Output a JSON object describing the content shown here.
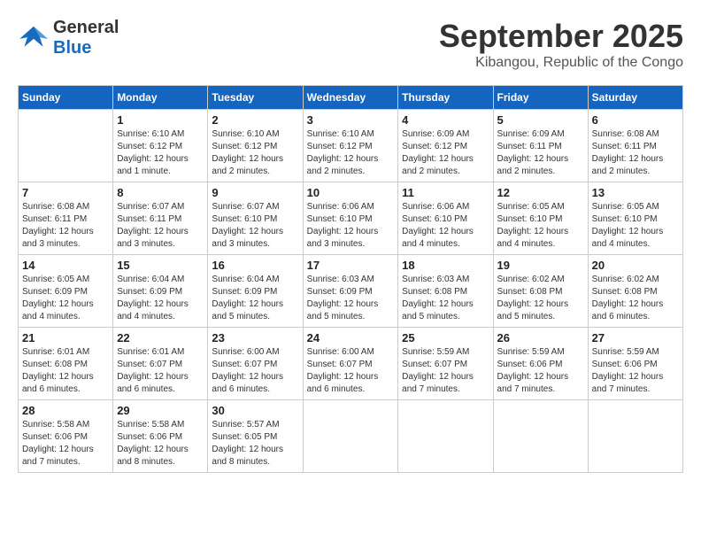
{
  "header": {
    "logo_general": "General",
    "logo_blue": "Blue",
    "month": "September 2025",
    "location": "Kibangou, Republic of the Congo"
  },
  "days_of_week": [
    "Sunday",
    "Monday",
    "Tuesday",
    "Wednesday",
    "Thursday",
    "Friday",
    "Saturday"
  ],
  "weeks": [
    [
      {
        "day": "",
        "sunrise": "",
        "sunset": "",
        "daylight": ""
      },
      {
        "day": "1",
        "sunrise": "Sunrise: 6:10 AM",
        "sunset": "Sunset: 6:12 PM",
        "daylight": "Daylight: 12 hours and 1 minute."
      },
      {
        "day": "2",
        "sunrise": "Sunrise: 6:10 AM",
        "sunset": "Sunset: 6:12 PM",
        "daylight": "Daylight: 12 hours and 2 minutes."
      },
      {
        "day": "3",
        "sunrise": "Sunrise: 6:10 AM",
        "sunset": "Sunset: 6:12 PM",
        "daylight": "Daylight: 12 hours and 2 minutes."
      },
      {
        "day": "4",
        "sunrise": "Sunrise: 6:09 AM",
        "sunset": "Sunset: 6:12 PM",
        "daylight": "Daylight: 12 hours and 2 minutes."
      },
      {
        "day": "5",
        "sunrise": "Sunrise: 6:09 AM",
        "sunset": "Sunset: 6:11 PM",
        "daylight": "Daylight: 12 hours and 2 minutes."
      },
      {
        "day": "6",
        "sunrise": "Sunrise: 6:08 AM",
        "sunset": "Sunset: 6:11 PM",
        "daylight": "Daylight: 12 hours and 2 minutes."
      }
    ],
    [
      {
        "day": "7",
        "sunrise": "Sunrise: 6:08 AM",
        "sunset": "Sunset: 6:11 PM",
        "daylight": "Daylight: 12 hours and 3 minutes."
      },
      {
        "day": "8",
        "sunrise": "Sunrise: 6:07 AM",
        "sunset": "Sunset: 6:11 PM",
        "daylight": "Daylight: 12 hours and 3 minutes."
      },
      {
        "day": "9",
        "sunrise": "Sunrise: 6:07 AM",
        "sunset": "Sunset: 6:10 PM",
        "daylight": "Daylight: 12 hours and 3 minutes."
      },
      {
        "day": "10",
        "sunrise": "Sunrise: 6:06 AM",
        "sunset": "Sunset: 6:10 PM",
        "daylight": "Daylight: 12 hours and 3 minutes."
      },
      {
        "day": "11",
        "sunrise": "Sunrise: 6:06 AM",
        "sunset": "Sunset: 6:10 PM",
        "daylight": "Daylight: 12 hours and 4 minutes."
      },
      {
        "day": "12",
        "sunrise": "Sunrise: 6:05 AM",
        "sunset": "Sunset: 6:10 PM",
        "daylight": "Daylight: 12 hours and 4 minutes."
      },
      {
        "day": "13",
        "sunrise": "Sunrise: 6:05 AM",
        "sunset": "Sunset: 6:10 PM",
        "daylight": "Daylight: 12 hours and 4 minutes."
      }
    ],
    [
      {
        "day": "14",
        "sunrise": "Sunrise: 6:05 AM",
        "sunset": "Sunset: 6:09 PM",
        "daylight": "Daylight: 12 hours and 4 minutes."
      },
      {
        "day": "15",
        "sunrise": "Sunrise: 6:04 AM",
        "sunset": "Sunset: 6:09 PM",
        "daylight": "Daylight: 12 hours and 4 minutes."
      },
      {
        "day": "16",
        "sunrise": "Sunrise: 6:04 AM",
        "sunset": "Sunset: 6:09 PM",
        "daylight": "Daylight: 12 hours and 5 minutes."
      },
      {
        "day": "17",
        "sunrise": "Sunrise: 6:03 AM",
        "sunset": "Sunset: 6:09 PM",
        "daylight": "Daylight: 12 hours and 5 minutes."
      },
      {
        "day": "18",
        "sunrise": "Sunrise: 6:03 AM",
        "sunset": "Sunset: 6:08 PM",
        "daylight": "Daylight: 12 hours and 5 minutes."
      },
      {
        "day": "19",
        "sunrise": "Sunrise: 6:02 AM",
        "sunset": "Sunset: 6:08 PM",
        "daylight": "Daylight: 12 hours and 5 minutes."
      },
      {
        "day": "20",
        "sunrise": "Sunrise: 6:02 AM",
        "sunset": "Sunset: 6:08 PM",
        "daylight": "Daylight: 12 hours and 6 minutes."
      }
    ],
    [
      {
        "day": "21",
        "sunrise": "Sunrise: 6:01 AM",
        "sunset": "Sunset: 6:08 PM",
        "daylight": "Daylight: 12 hours and 6 minutes."
      },
      {
        "day": "22",
        "sunrise": "Sunrise: 6:01 AM",
        "sunset": "Sunset: 6:07 PM",
        "daylight": "Daylight: 12 hours and 6 minutes."
      },
      {
        "day": "23",
        "sunrise": "Sunrise: 6:00 AM",
        "sunset": "Sunset: 6:07 PM",
        "daylight": "Daylight: 12 hours and 6 minutes."
      },
      {
        "day": "24",
        "sunrise": "Sunrise: 6:00 AM",
        "sunset": "Sunset: 6:07 PM",
        "daylight": "Daylight: 12 hours and 6 minutes."
      },
      {
        "day": "25",
        "sunrise": "Sunrise: 5:59 AM",
        "sunset": "Sunset: 6:07 PM",
        "daylight": "Daylight: 12 hours and 7 minutes."
      },
      {
        "day": "26",
        "sunrise": "Sunrise: 5:59 AM",
        "sunset": "Sunset: 6:06 PM",
        "daylight": "Daylight: 12 hours and 7 minutes."
      },
      {
        "day": "27",
        "sunrise": "Sunrise: 5:59 AM",
        "sunset": "Sunset: 6:06 PM",
        "daylight": "Daylight: 12 hours and 7 minutes."
      }
    ],
    [
      {
        "day": "28",
        "sunrise": "Sunrise: 5:58 AM",
        "sunset": "Sunset: 6:06 PM",
        "daylight": "Daylight: 12 hours and 7 minutes."
      },
      {
        "day": "29",
        "sunrise": "Sunrise: 5:58 AM",
        "sunset": "Sunset: 6:06 PM",
        "daylight": "Daylight: 12 hours and 8 minutes."
      },
      {
        "day": "30",
        "sunrise": "Sunrise: 5:57 AM",
        "sunset": "Sunset: 6:05 PM",
        "daylight": "Daylight: 12 hours and 8 minutes."
      },
      {
        "day": "",
        "sunrise": "",
        "sunset": "",
        "daylight": ""
      },
      {
        "day": "",
        "sunrise": "",
        "sunset": "",
        "daylight": ""
      },
      {
        "day": "",
        "sunrise": "",
        "sunset": "",
        "daylight": ""
      },
      {
        "day": "",
        "sunrise": "",
        "sunset": "",
        "daylight": ""
      }
    ]
  ]
}
